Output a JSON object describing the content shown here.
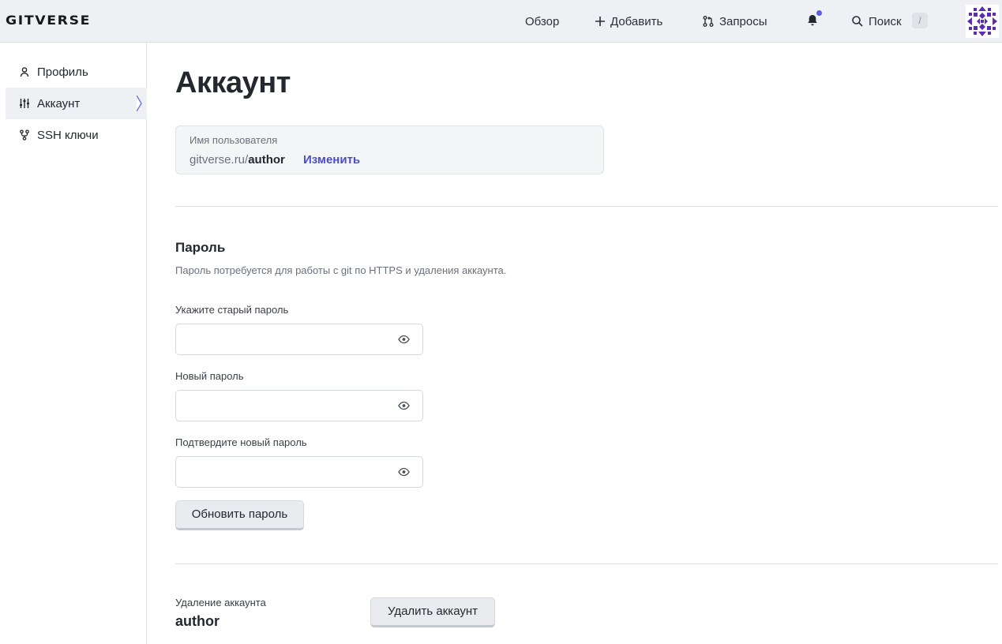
{
  "header": {
    "logo": "GITVERSE",
    "nav": {
      "overview": "Обзор",
      "add": "Добавить",
      "requests": "Запросы",
      "search": "Поиск",
      "search_shortcut": "/"
    },
    "notification_dot_color": "#5a5ee8"
  },
  "sidebar": {
    "items": [
      {
        "label": "Профиль",
        "icon": "user-icon"
      },
      {
        "label": "Аккаунт",
        "icon": "sliders-icon",
        "active": true
      },
      {
        "label": "SSH ключи",
        "icon": "key-fork-icon"
      }
    ]
  },
  "main": {
    "title": "Аккаунт",
    "username_card": {
      "label": "Имя пользователя",
      "domain": "gitverse.ru/",
      "username": "author",
      "change_link": "Изменить"
    },
    "password": {
      "title": "Пароль",
      "description": "Пароль потребуется для работы с git по HTTPS и удаления аккаунта.",
      "old_label": "Укажите старый пароль",
      "new_label": "Новый пароль",
      "confirm_label": "Подтвердите новый пароль",
      "update_button": "Обновить пароль"
    },
    "delete": {
      "label": "Удаление аккаунта",
      "username": "author",
      "button": "Удалить аккаунт"
    }
  },
  "colors": {
    "accent": "#4a4fc9",
    "header_bg": "#eef0f3"
  }
}
